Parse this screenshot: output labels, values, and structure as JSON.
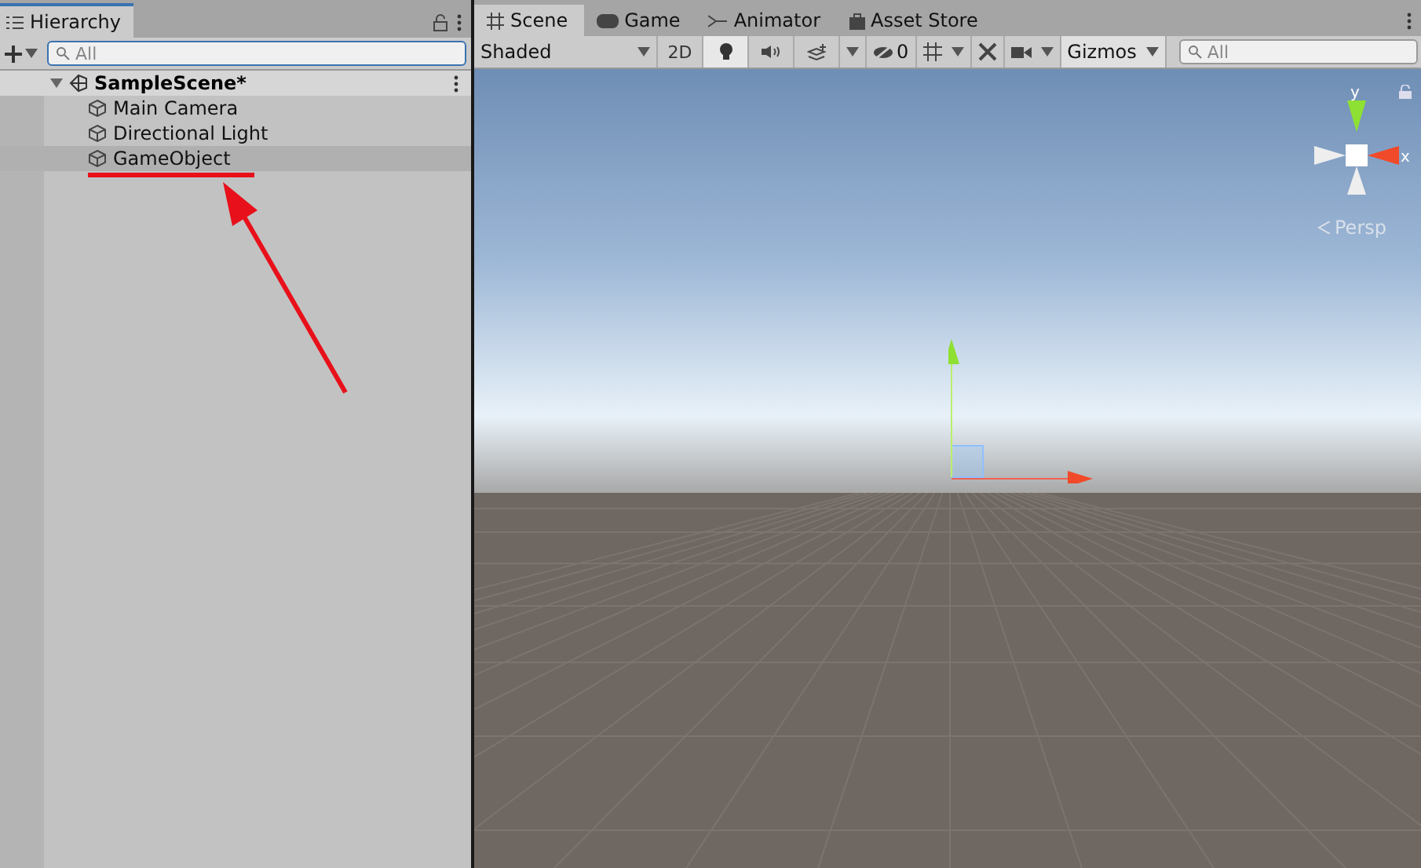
{
  "hierarchy": {
    "tab": {
      "label": "Hierarchy",
      "selected": true
    },
    "search": {
      "placeholder": "All"
    },
    "scene": {
      "name": "SampleScene*",
      "expanded": true,
      "children": [
        {
          "name": "Main Camera",
          "selected": false
        },
        {
          "name": "Directional Light",
          "selected": false
        },
        {
          "name": "GameObject",
          "selected": true
        }
      ]
    }
  },
  "scene_tabs": [
    {
      "label": "Scene",
      "kind": "grid",
      "selected": true
    },
    {
      "label": "Game",
      "kind": "gamepad",
      "selected": false
    },
    {
      "label": "Animator",
      "kind": "animator",
      "selected": false
    },
    {
      "label": "Asset Store",
      "kind": "bag",
      "selected": false
    }
  ],
  "toolbar": {
    "draw_mode": "Shaded",
    "toggles": [
      {
        "kind": "flat",
        "label": "2D",
        "on": false
      },
      {
        "kind": "light",
        "on": true
      },
      {
        "kind": "audio",
        "on": false
      },
      {
        "kind": "effects",
        "on": false
      }
    ],
    "hidden_count": "0",
    "gizmos": "Gizmos",
    "search": {
      "placeholder": "All"
    }
  },
  "gizmo": {
    "y": "y",
    "x": "x",
    "projection": "Persp"
  }
}
